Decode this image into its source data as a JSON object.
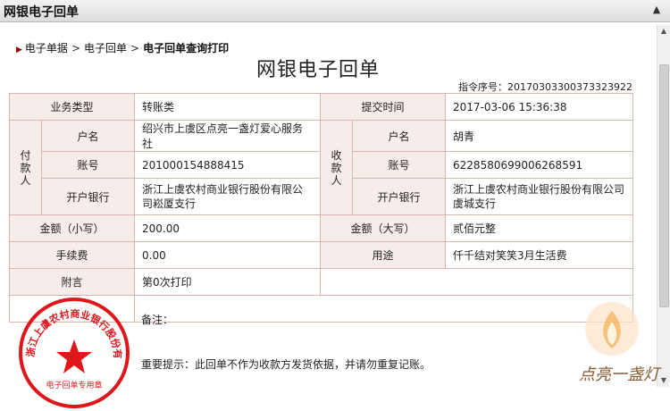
{
  "window": {
    "title": "网银电子回单"
  },
  "breadcrumb": {
    "items": [
      "电子单据",
      "电子回单"
    ],
    "current": "电子回单查询打印",
    "separator": ">"
  },
  "document": {
    "title": "网银电子回单",
    "serial_label": "指令序号：",
    "serial_value": "20170303300373323922"
  },
  "fields": {
    "business_type_label": "业务类型",
    "business_type_value": "转账类",
    "submit_time_label": "提交时间",
    "submit_time_value": "2017-03-06 15:36:38",
    "payer_side_label": "付款人",
    "payee_side_label": "收款人",
    "account_name_label": "户名",
    "account_no_label": "账号",
    "bank_label": "开户银行",
    "payer": {
      "name": "绍兴市上虞区点亮一盏灯爱心服务社",
      "account": "201000154888415",
      "bank": "浙江上虞农村商业银行股份有限公司崧厦支行"
    },
    "payee": {
      "name": "胡青",
      "account": "6228580699006268591",
      "bank": "浙江上虞农村商业银行股份有限公司虞城支行"
    },
    "amount_small_label": "金额（小写）",
    "amount_small_value": "200.00",
    "amount_big_label": "金额（大写）",
    "amount_big_value": "贰佰元整",
    "fee_label": "手续费",
    "fee_value": "0.00",
    "purpose_label": "用途",
    "purpose_value": "仟千结对笑笑3月生活费",
    "remark_label": "附言",
    "remark_value": "第0次打印",
    "note_label": "备注：",
    "important_text": "重要提示：此回单不作为收款方发货依据，并请勿重复记账。"
  },
  "seal": {
    "text": "浙江上虞农村商业银行股份有限公司",
    "bottom_text": "电子回单专用章",
    "color": "#e0161b"
  },
  "watermark": {
    "text": "点亮一盏灯"
  },
  "colors": {
    "label_bg": "#f6ecea",
    "border": "#d9b7b0",
    "accent": "#8b0000"
  }
}
